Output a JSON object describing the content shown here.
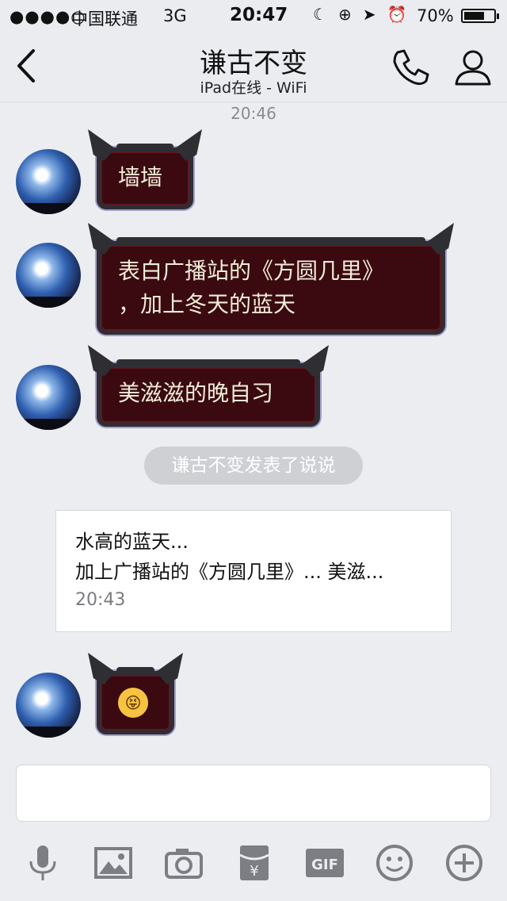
{
  "status_bar": {
    "signal": "●●●●○",
    "carrier": "中国联通",
    "network": "3G",
    "time": "20:47",
    "icons": [
      "moon-icon",
      "rotation-lock-icon",
      "location-arrow-icon",
      "alarm-icon"
    ],
    "battery_percent": "70%",
    "battery_level": 0.7
  },
  "nav": {
    "title": "谦古不变",
    "subtitle": "iPad在线 - WiFi",
    "icons": [
      "back-chevron-icon",
      "phone-icon",
      "user-profile-icon"
    ]
  },
  "timestamp": "20:46",
  "messages": [
    {
      "text": "墙墙"
    },
    {
      "line1": "表白广播站的《方圆几里》",
      "line2": "，加上冬天的蓝天"
    },
    {
      "text": "美滋滋的晚自习"
    }
  ],
  "system_notice": "谦古不变发表了说说",
  "shared_post": {
    "line1": "水高的蓝天...",
    "line2": "加上广播站的《方圆几里》... 美滋...",
    "time": "20:43"
  },
  "emoji_message": "😝",
  "input": {
    "placeholder": ""
  },
  "toolbar": [
    "microphone-icon",
    "image-icon",
    "camera-icon",
    "red-packet-icon",
    "gif-icon",
    "emoji-icon",
    "plus-icon"
  ],
  "toolbar_gif_label": "GIF",
  "toolbar_redpacket_label": "¥",
  "colors": {
    "background": "#ecedf1",
    "bubble": "#3a0a10",
    "bubble_frame": "#2e2e33",
    "pill": "#cfd0d4"
  }
}
